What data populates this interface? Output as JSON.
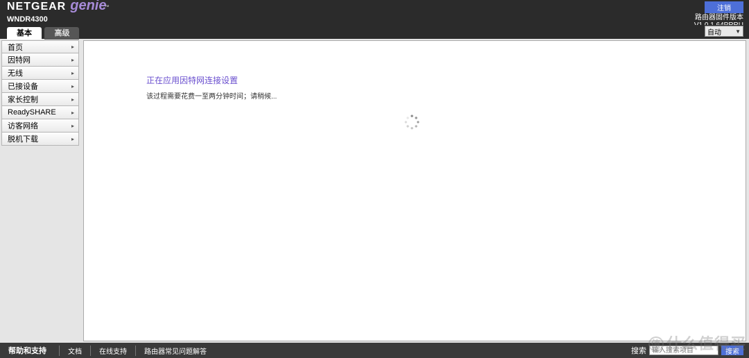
{
  "brand": {
    "name": "NETGEAR",
    "sub": "genie",
    "tm": "™"
  },
  "model": "WNDR4300",
  "header": {
    "logout": "注销",
    "fw_label": "路由器固件版本",
    "fw_version": "V1.0.1.64PRRU"
  },
  "tabs": {
    "basic": "基本",
    "advanced": "高级"
  },
  "language": {
    "selected": "自动"
  },
  "sidebar": {
    "items": [
      {
        "id": "home",
        "label": "首页"
      },
      {
        "id": "internet",
        "label": "因特网"
      },
      {
        "id": "wireless",
        "label": "无线"
      },
      {
        "id": "attached",
        "label": "已接设备"
      },
      {
        "id": "parental",
        "label": "家长控制"
      },
      {
        "id": "readyshare",
        "label": "ReadySHARE"
      },
      {
        "id": "guest",
        "label": "访客网络"
      },
      {
        "id": "download",
        "label": "脱机下载"
      }
    ]
  },
  "content": {
    "title": "正在应用因特网连接设置",
    "text": "该过程需要花费一至两分钟时间；请稍候..."
  },
  "footer": {
    "title": "帮助和支持",
    "links": [
      "文档",
      "在线支持",
      "路由器常见问题解答"
    ],
    "search_label": "搜索",
    "search_placeholder": "输入搜索项目",
    "search_button": "搜索"
  },
  "watermark": "什么值得买"
}
